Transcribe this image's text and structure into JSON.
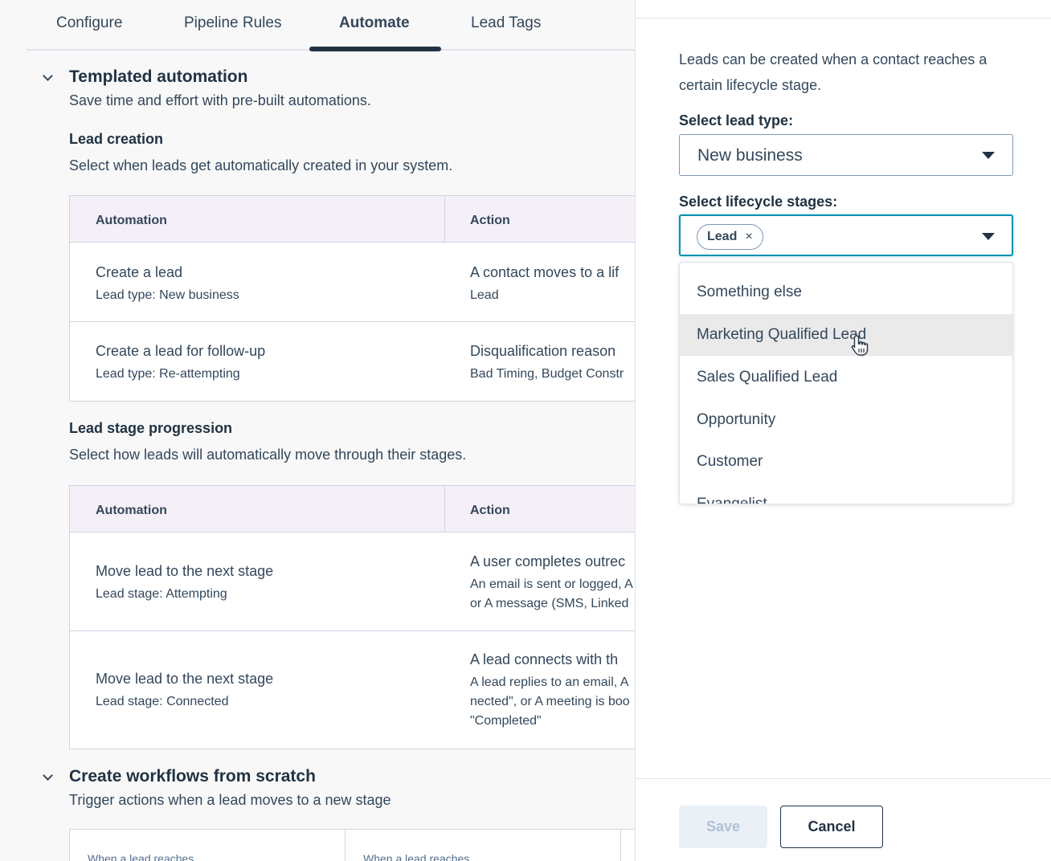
{
  "tabs": [
    "Configure",
    "Pipeline Rules",
    "Automate",
    "Lead Tags"
  ],
  "active_tab": "Automate",
  "templated": {
    "title": "Templated automation",
    "subtitle": "Save time and effort with pre-built automations."
  },
  "lead_creation": {
    "title": "Lead creation",
    "subtitle": "Select when leads get automatically created in your system.",
    "col_automation": "Automation",
    "col_action": "Action",
    "rows": [
      {
        "title": "Create a lead",
        "sub": "Lead type: New business",
        "action": "A contact moves to a lif",
        "action_sub": "Lead"
      },
      {
        "title": "Create a lead for follow-up",
        "sub": "Lead type: Re-attempting",
        "action": "Disqualification reason",
        "action_sub": "Bad Timing, Budget Constr"
      }
    ]
  },
  "lead_stage": {
    "title": "Lead stage progression",
    "subtitle": "Select how leads will automatically move through their stages.",
    "col_automation": "Automation",
    "col_action": "Action",
    "rows": [
      {
        "title": "Move lead to the next stage",
        "sub": "Lead stage: Attempting",
        "action": "A user completes outrec",
        "action_lines": [
          "An email is sent or logged, A",
          "or A message (SMS, Linked"
        ]
      },
      {
        "title": "Move lead to the next stage",
        "sub": "Lead stage: Connected",
        "action": "A lead connects with th",
        "action_lines": [
          "A lead replies to an email, A",
          "nected\", or A meeting is boo",
          "\"Completed\""
        ]
      }
    ]
  },
  "scratch": {
    "title": "Create workflows from scratch",
    "subtitle": "Trigger actions when a lead moves to a new stage",
    "cards": [
      "When a lead reaches",
      "When a lead reaches"
    ]
  },
  "drawer": {
    "description": "Leads can be created when a contact reaches a certain lifecycle stage.",
    "lead_type_label": "Select lead type:",
    "lead_type_value": "New business",
    "lifecycle_label": "Select lifecycle stages:",
    "selected_chip": "Lead",
    "chip_remove": "×",
    "options": [
      "Something else",
      "Marketing Qualified Lead",
      "Sales Qualified Lead",
      "Opportunity",
      "Customer",
      "Evangelist"
    ],
    "hovered_option": "Marketing Qualified Lead",
    "save_label": "Save",
    "cancel_label": "Cancel"
  },
  "icons": {
    "chevron": "chevron-down-icon",
    "caret": "caret-down-icon",
    "cursor": "hand-pointer-icon"
  },
  "colors": {
    "text": "#33475b",
    "heading": "#213343",
    "table_header_bg": "#f5f0f8",
    "focus": "#0091ae",
    "hover_row": "#eaeaea"
  }
}
